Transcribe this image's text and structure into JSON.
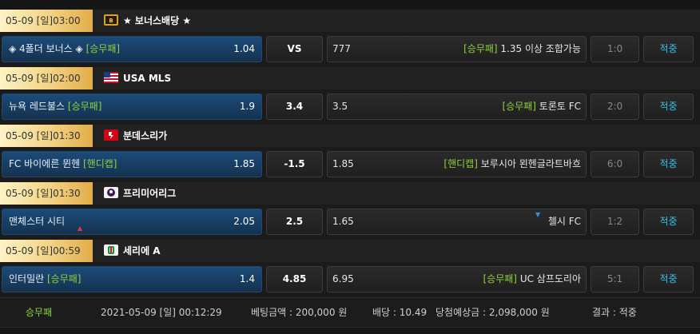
{
  "matches": [
    {
      "time": "05-09 [일]03:00",
      "league": "★ 보너스배당 ★",
      "flag_icon": "bonus-icon",
      "home": "◈ 4폴더 보너스 ◈",
      "home_market": "[승무패]",
      "home_odds": "1.04",
      "draw": "VS",
      "away_odds": "777",
      "away_market": "[승무패]",
      "away": "1.35 이상 조합가능",
      "score": "1:0",
      "status": "적중"
    },
    {
      "time": "05-09 [일]02:00",
      "league": "USA MLS",
      "flag_icon": "usa-flag-icon",
      "home": "뉴욕 레드불스",
      "home_market": "[승무패]",
      "home_odds": "1.9",
      "draw": "3.4",
      "away_odds": "3.5",
      "away_market": "[승무패]",
      "away": "토론토 FC",
      "score": "2:0",
      "status": "적중"
    },
    {
      "time": "05-09 [일]01:30",
      "league": "분데스리가",
      "flag_icon": "bundesliga-icon",
      "home": "FC 바이에른 뮌헨",
      "home_market": "[핸디캡]",
      "home_odds": "1.85",
      "draw": "-1.5",
      "away_odds": "1.85",
      "away_market": "[핸디캡]",
      "away": "보루시아 묀헨글라트바흐",
      "score": "6:0",
      "status": "적중"
    },
    {
      "time": "05-09 [일]01:30",
      "league": "프리미어리그",
      "flag_icon": "premier-league-icon",
      "home": "맨체스터 시티",
      "home_market": "",
      "home_odds": "2.05",
      "draw": "2.5",
      "away_odds": "1.65",
      "away_market": "",
      "away": "첼시 FC",
      "score": "1:2",
      "status": "적중"
    },
    {
      "time": "05-09 [일]00:59",
      "league": "세리에 A",
      "flag_icon": "serie-a-icon",
      "home": "인터밀란",
      "home_market": "[승무패]",
      "home_odds": "1.4",
      "draw": "4.85",
      "away_odds": "6.95",
      "away_market": "[승무패]",
      "away": "UC 삼프도리아",
      "score": "5:1",
      "status": "적중"
    }
  ],
  "footer": {
    "type": "승무패",
    "datetime": "2021-05-09 [일] 00:12:29",
    "bet_amount": "베팅금액 : 200,000 원",
    "odds": "배당 : 10.49",
    "expected_win": "당첨예상금 : 2,098,000 원",
    "result": "결과 : 적중"
  },
  "colors": {
    "time_tag_gold": "#e1ad48",
    "home_blue": "#1b4b7a",
    "market_green": "#8fd43b",
    "status_cyan": "#37c3ea"
  }
}
